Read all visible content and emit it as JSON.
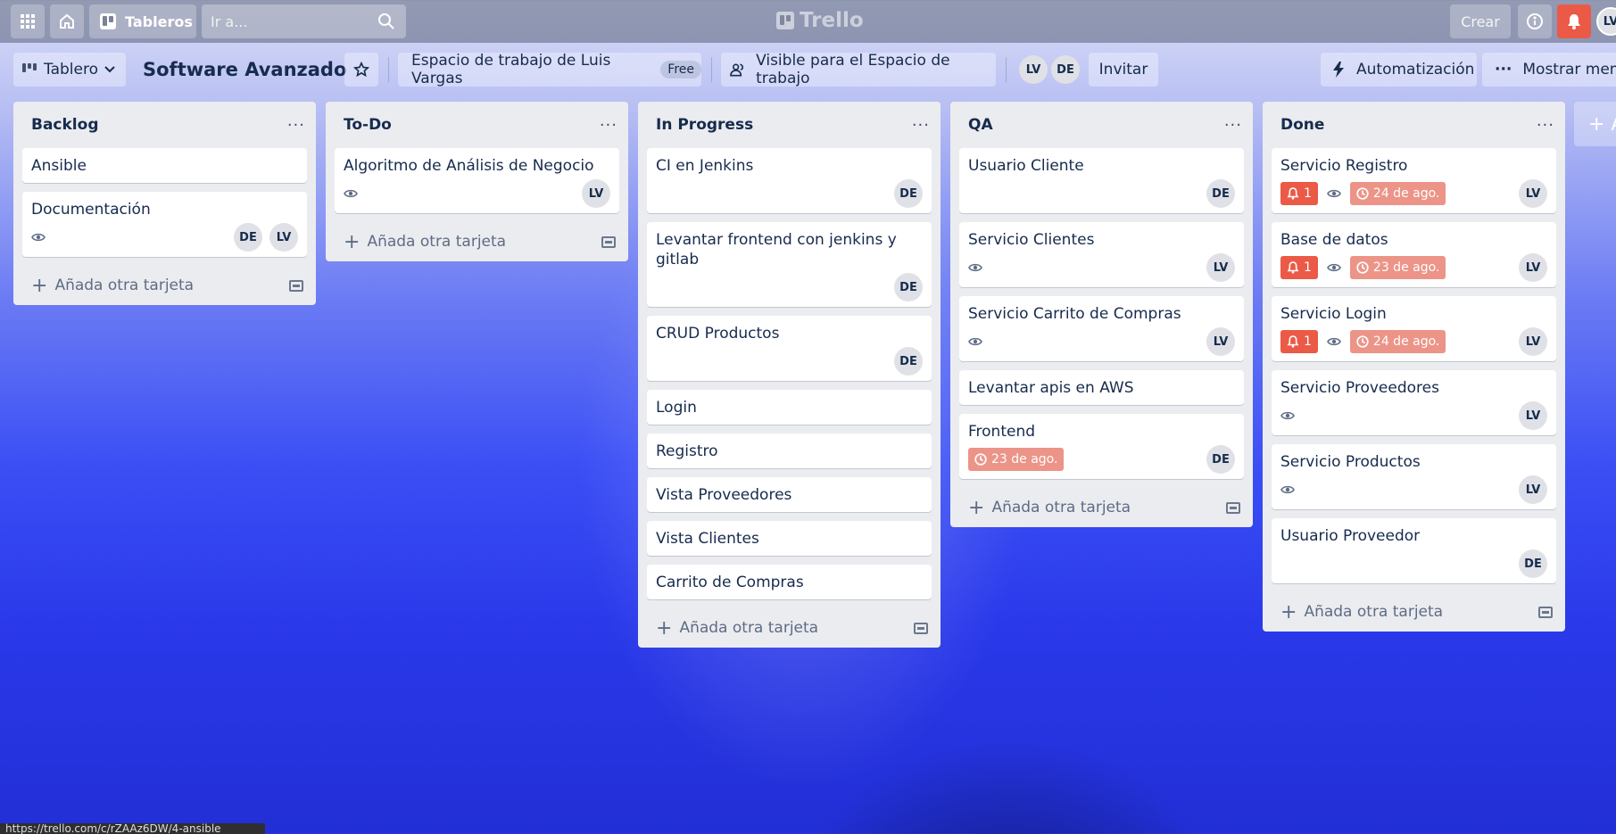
{
  "topbar": {
    "boards_label": "Tableros",
    "search_placeholder": "Ir a...",
    "logo_text": "Trello",
    "create_label": "Crear",
    "user_initials": "LV"
  },
  "board": {
    "view_label": "Tablero",
    "title": "Software Avanzado",
    "workspace_label": "Espacio de trabajo de Luis Vargas",
    "plan_badge": "Free",
    "visibility_label": "Visible para el Espacio de trabajo",
    "members": [
      "LV",
      "DE"
    ],
    "invite_label": "Invitar",
    "automation_label": "Automatización",
    "show_menu_label": "Mostrar menú"
  },
  "add_card_label": "Añada otra tarjeta",
  "lists": [
    {
      "title": "Backlog",
      "cards": [
        {
          "title": "Ansible"
        },
        {
          "title": "Documentación",
          "watch": true,
          "members": [
            "DE",
            "LV"
          ]
        }
      ]
    },
    {
      "title": "To-Do",
      "cards": [
        {
          "title": "Algoritmo de Análisis de Negocio",
          "watch": true,
          "members": [
            "LV"
          ]
        }
      ]
    },
    {
      "title": "In Progress",
      "cards": [
        {
          "title": "CI en Jenkins",
          "members": [
            "DE"
          ]
        },
        {
          "title": "Levantar frontend con jenkins y gitlab",
          "members": [
            "DE"
          ]
        },
        {
          "title": "CRUD Productos",
          "members": [
            "DE"
          ]
        },
        {
          "title": "Login"
        },
        {
          "title": "Registro"
        },
        {
          "title": "Vista Proveedores"
        },
        {
          "title": "Vista Clientes"
        },
        {
          "title": "Carrito de Compras"
        }
      ]
    },
    {
      "title": "QA",
      "cards": [
        {
          "title": "Usuario Cliente",
          "members": [
            "DE"
          ]
        },
        {
          "title": "Servicio Clientes",
          "watch": true,
          "members": [
            "LV"
          ]
        },
        {
          "title": "Servicio Carrito de Compras",
          "watch": true,
          "members": [
            "LV"
          ]
        },
        {
          "title": "Levantar apis en AWS"
        },
        {
          "title": "Frontend",
          "due": "23 de ago.",
          "members": [
            "DE"
          ]
        }
      ]
    },
    {
      "title": "Done",
      "cards": [
        {
          "title": "Servicio Registro",
          "notifications": "1",
          "watch": true,
          "due": "24 de ago.",
          "members": [
            "LV"
          ]
        },
        {
          "title": "Base de datos",
          "notifications": "1",
          "watch": true,
          "due": "23 de ago.",
          "members": [
            "LV"
          ]
        },
        {
          "title": "Servicio Login",
          "notifications": "1",
          "watch": true,
          "due": "24 de ago.",
          "members": [
            "LV"
          ]
        },
        {
          "title": "Servicio Proveedores",
          "watch": true,
          "members": [
            "LV"
          ]
        },
        {
          "title": "Servicio Productos",
          "watch": true,
          "members": [
            "LV"
          ]
        },
        {
          "title": "Usuario Proveedor",
          "members": [
            "DE"
          ]
        }
      ]
    }
  ],
  "add_list_label": "+ A",
  "status_url": "https://trello.com/c/rZAAz6DW/4-ansible"
}
